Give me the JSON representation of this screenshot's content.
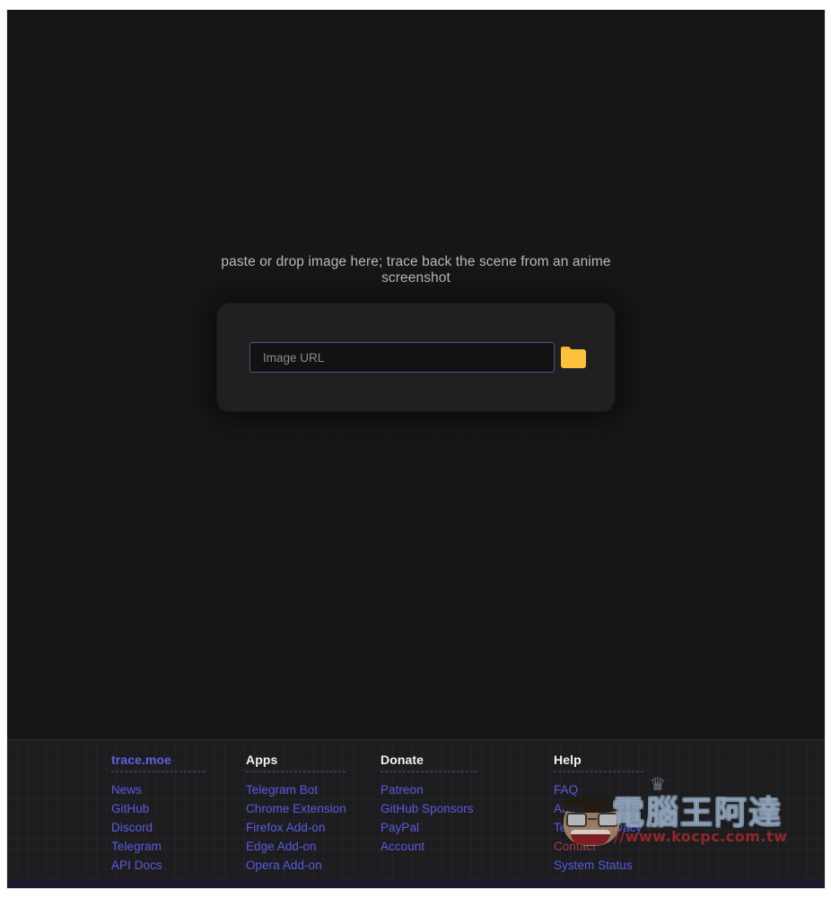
{
  "hero": {
    "drop_hint": "paste or drop image here; trace back the scene from an anime screenshot",
    "url_input_value": "",
    "url_input_placeholder": "Image URL",
    "folder_icon": "folder-open-icon"
  },
  "footer": {
    "columns": [
      {
        "heading": "trace.moe",
        "heading_is_link": true,
        "links": [
          "News",
          "GitHub",
          "Discord",
          "Telegram",
          "API Docs"
        ]
      },
      {
        "heading": "Apps",
        "heading_is_link": false,
        "links": [
          "Telegram Bot",
          "Chrome Extension",
          "Firefox Add-on",
          "Edge Add-on",
          "Opera Add-on"
        ]
      },
      {
        "heading": "Donate",
        "heading_is_link": false,
        "links": [
          "Patreon",
          "GitHub Sponsors",
          "PayPal",
          "Account"
        ]
      },
      {
        "heading": "Help",
        "heading_is_link": false,
        "links": [
          "FAQ",
          "About",
          "Terms & Privacy",
          "Contact",
          "System Status"
        ]
      }
    ]
  },
  "watermark": {
    "brand_text": "電腦王阿達",
    "url_text": "//www.kocpc.com.tw",
    "crown_glyph": "♛",
    "face_icon": "mascot-face-icon"
  },
  "colors": {
    "page_background": "#161616",
    "footer_background": "#1d1d20",
    "link": "#5a5ade",
    "heading": "#f1f1f1",
    "hint_text": "#b9b9b9",
    "input_border": "#514f86",
    "folder_icon": "#fec13c",
    "watermark_url": "#c42c30"
  }
}
